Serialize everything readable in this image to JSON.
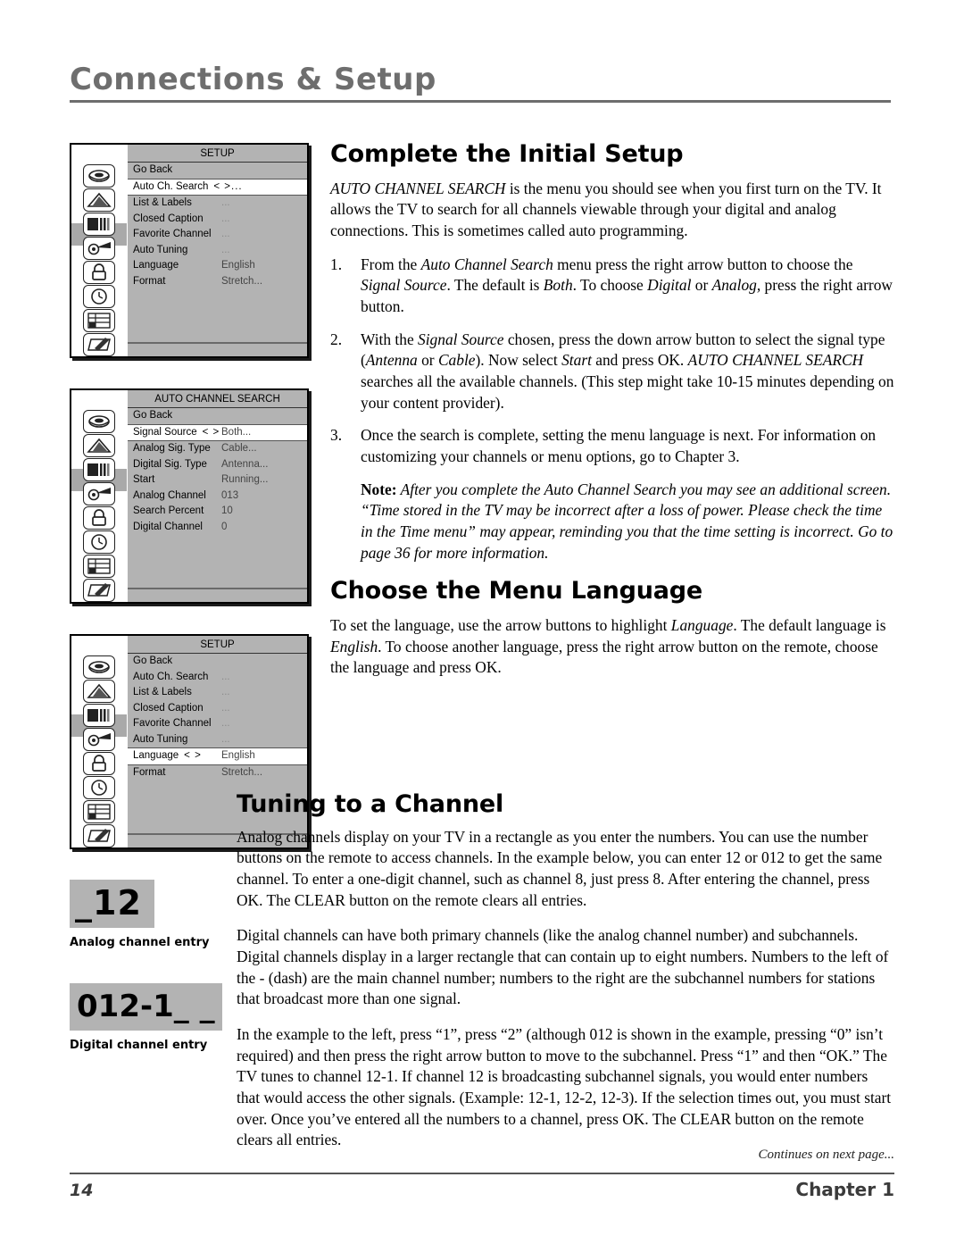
{
  "header": {
    "title": "Connections & Setup"
  },
  "menus": [
    {
      "name": "setup-menu-initial",
      "title": "SETUP",
      "highlight_index": 1,
      "rows": [
        {
          "label": "Go Back",
          "arrows": "",
          "value": ""
        },
        {
          "label": "Auto Ch. Search",
          "arrows": "< >...",
          "value": ""
        },
        {
          "label": "List & Labels",
          "arrows": "",
          "value": "..."
        },
        {
          "label": "Closed Caption",
          "arrows": "",
          "value": "..."
        },
        {
          "label": "Favorite Channel",
          "arrows": "",
          "value": "..."
        },
        {
          "label": "Auto Tuning",
          "arrows": "",
          "value": "..."
        },
        {
          "label": "Language",
          "arrows": "",
          "value": "English"
        },
        {
          "label": "Format",
          "arrows": "",
          "value": "Stretch..."
        }
      ]
    },
    {
      "name": "auto-channel-search-menu",
      "title": "AUTO CHANNEL SEARCH",
      "highlight_index": 1,
      "rows": [
        {
          "label": "Go Back",
          "arrows": "",
          "value": ""
        },
        {
          "label": "Signal Source",
          "arrows": "< >",
          "value": "Both..."
        },
        {
          "label": "Analog Sig. Type",
          "arrows": "",
          "value": "Cable..."
        },
        {
          "label": "Digital Sig. Type",
          "arrows": "",
          "value": "Antenna..."
        },
        {
          "label": "Start",
          "arrows": "",
          "value": "Running..."
        },
        {
          "label": "Analog Channel",
          "arrows": "",
          "value": "013"
        },
        {
          "label": "Search Percent",
          "arrows": "",
          "value": "10"
        },
        {
          "label": "Digital Channel",
          "arrows": "",
          "value": "0"
        }
      ]
    },
    {
      "name": "setup-menu-language",
      "title": "SETUP",
      "highlight_index": 6,
      "rows": [
        {
          "label": "Go Back",
          "arrows": "",
          "value": ""
        },
        {
          "label": "Auto Ch. Search",
          "arrows": "",
          "value": "..."
        },
        {
          "label": "List & Labels",
          "arrows": "",
          "value": "..."
        },
        {
          "label": "Closed Caption",
          "arrows": "",
          "value": "..."
        },
        {
          "label": "Favorite Channel",
          "arrows": "",
          "value": "..."
        },
        {
          "label": "Auto Tuning",
          "arrows": "",
          "value": "..."
        },
        {
          "label": "Language",
          "arrows": "< >",
          "value": "English"
        },
        {
          "label": "Format",
          "arrows": "",
          "value": "Stretch..."
        }
      ]
    }
  ],
  "icon_rail": [
    "audio-disc-icon",
    "picture-icon",
    "channel-bars-icon",
    "setup-dish-icon",
    "parental-lock-icon",
    "clock-time-icon",
    "screen-grid-icon",
    "edit-notes-icon"
  ],
  "channel_examples": [
    {
      "name": "analog-channel-entry",
      "display": "_12",
      "caption": "Analog channel entry"
    },
    {
      "name": "digital-channel-entry",
      "display": "012-1_ _",
      "caption": "Digital channel entry"
    }
  ],
  "sections": {
    "initial_setup": {
      "heading": "Complete the Initial Setup",
      "intro": "AUTO CHANNEL SEARCH is the menu you should see when you first turn on the TV. It allows the TV to search for all channels viewable through your digital and analog connections. This is sometimes called auto programming.",
      "steps": [
        {
          "num": "1.",
          "text": "From the Auto Channel Search menu press the right arrow button to choose the Signal Source. The default is Both. To choose Digital or Analog, press the right arrow button."
        },
        {
          "num": "2.",
          "text": "With the Signal Source chosen, press the down arrow button to select the signal type (Antenna or Cable). Now select Start and press OK. AUTO CHANNEL SEARCH searches all the available channels. (This step might take 10-15 minutes depending on your content provider)."
        },
        {
          "num": "3.",
          "text": "Once the search is complete, setting the menu language is next. For information on customizing your channels or menu options, go to Chapter 3."
        }
      ],
      "note_label": "Note:",
      "note_text": "After you complete the Auto Channel Search you may see an additional screen. “Time stored in the TV may be incorrect after a loss of power. Please check the time in the Time menu” may appear, reminding you that the time setting is incorrect. Go to page 36 for more information."
    },
    "menu_language": {
      "heading": "Choose the Menu Language",
      "body": "To set the language, use the arrow buttons to highlight Language. The default language is English. To choose another language, press the right arrow button on the remote, choose the language and press OK."
    },
    "tuning": {
      "heading": "Tuning to a Channel",
      "p1": "Analog channels display on your TV in a rectangle as you enter the numbers. You can use the number buttons on the remote to access channels. In the example below, you can enter 12 or 012 to get the same channel. To enter a one-digit channel, such as channel 8, just press 8. After entering the channel, press OK. The CLEAR button on the remote clears all entries.",
      "p2": "Digital channels can have both primary channels (like the analog channel number) and subchannels. Digital channels display in a larger rectangle that can contain up to eight numbers. Numbers to the left of the - (dash) are the main channel number; numbers to the right are the subchannel numbers for stations that broadcast more than one signal.",
      "p3": "In the example to the left, press “1”, press “2” (although 012 is shown in the example, pressing “0” isn’t required) and then press the right arrow button to move to the subchannel. Press “1” and then “OK.” The TV tunes to channel 12-1. If channel 12 is broadcasting subchannel signals, you would enter numbers that would access the other signals. (Example: 12-1, 12-2, 12-3). If the selection times out, you must start over. Once you’ve entered all the numbers to a channel, press OK. The CLEAR button on the remote clears all entries."
    }
  },
  "footer": {
    "continues": "Continues on next page...",
    "page_number": "14",
    "chapter": "Chapter 1"
  },
  "colors": {
    "header_gray": "#6e6e6e",
    "menu_gray": "#b3b3b3",
    "highlight_white": "#ffffff",
    "rail_highlight": "#a9a9a9"
  }
}
